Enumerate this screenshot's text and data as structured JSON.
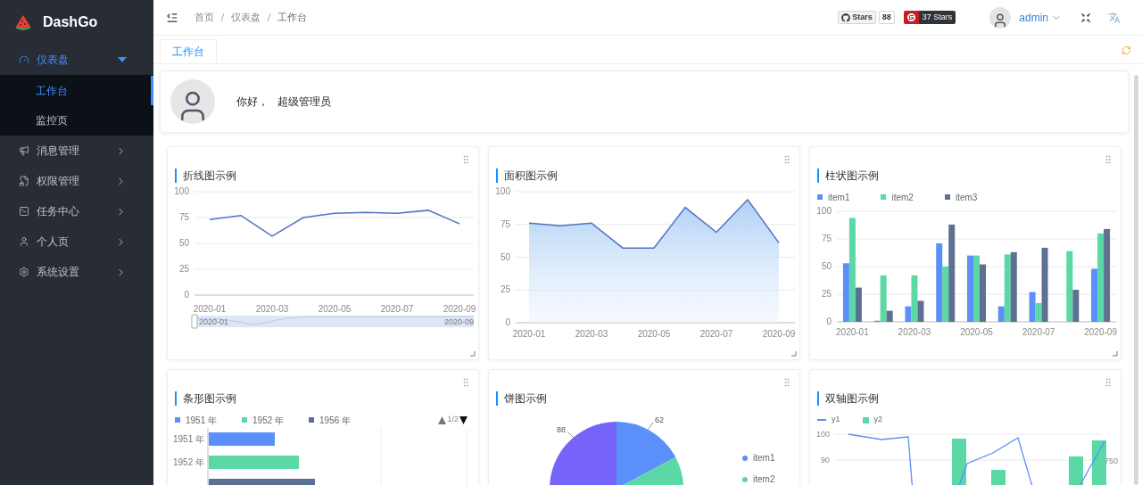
{
  "sidebar": {
    "logo": "DashGo",
    "menu": [
      {
        "label": "仪表盘",
        "selected": true,
        "expanded": true,
        "children": [
          {
            "label": "工作台",
            "selected": true
          },
          {
            "label": "监控页",
            "selected": false
          }
        ]
      },
      {
        "label": "消息管理",
        "selected": false,
        "expanded": false
      },
      {
        "label": "权限管理",
        "selected": false,
        "expanded": false
      },
      {
        "label": "任务中心",
        "selected": false,
        "expanded": false
      },
      {
        "label": "个人页",
        "selected": false,
        "expanded": false
      },
      {
        "label": "系统设置",
        "selected": false,
        "expanded": false
      }
    ]
  },
  "header": {
    "breadcrumb": [
      "首页",
      "仪表盘",
      "工作台"
    ],
    "github": {
      "label": "Stars",
      "count": "88"
    },
    "gitee": {
      "label": "37 Stars"
    },
    "user": "admin"
  },
  "tabs": [
    {
      "label": "工作台",
      "selected": true
    }
  ],
  "welcome": {
    "greeting": "你好，",
    "name": "超级管理员"
  },
  "cards": [
    {
      "kind": "line",
      "title": "折线图示例",
      "zoom_slider": {
        "start": "2020-01",
        "end": "2020-09"
      },
      "chart_data": {
        "type": "line",
        "categories": [
          "2020-01",
          null,
          "2020-03",
          null,
          "2020-05",
          null,
          "2020-07",
          null,
          "2020-09"
        ],
        "ylim": [
          0,
          100
        ],
        "yticks": [
          0,
          25,
          50,
          75,
          100
        ],
        "grid": true,
        "series": [
          {
            "color": "#5470c6",
            "values": [
              73,
              77,
              57,
              75,
              79,
              80,
              79,
              82,
              69
            ]
          }
        ]
      }
    },
    {
      "kind": "area",
      "title": "面积图示例",
      "chart_data": {
        "type": "area",
        "categories": [
          "2020-01",
          null,
          "2020-03",
          null,
          "2020-05",
          null,
          "2020-07",
          null,
          "2020-09"
        ],
        "ylim": [
          0,
          100
        ],
        "yticks": [
          0,
          25,
          50,
          75,
          100
        ],
        "grid": true,
        "series": [
          {
            "color": "#5470c6",
            "values": [
              76,
              74,
              76,
              57,
              57,
              88,
              69,
              94,
              61
            ]
          }
        ]
      }
    },
    {
      "kind": "bar",
      "title": "柱状图示例",
      "chart_data": {
        "type": "bar",
        "categories": [
          "2020-01",
          null,
          "2020-03",
          null,
          "2020-05",
          null,
          "2020-07",
          null,
          "2020-09"
        ],
        "ylim": [
          0,
          100
        ],
        "yticks": [
          0,
          25,
          50,
          75,
          100
        ],
        "grid": true,
        "series": [
          {
            "name": "item1",
            "color": "#5b8ff9",
            "values": [
              53,
              1,
              14,
              71,
              60,
              14,
              27,
              0,
              48
            ]
          },
          {
            "name": "item2",
            "color": "#5ad8a6",
            "values": [
              94,
              42,
              42,
              50,
              60,
              61,
              17,
              64,
              80
            ]
          },
          {
            "name": "item3",
            "color": "#5d7092",
            "values": [
              31,
              10,
              19,
              88,
              52,
              63,
              67,
              29,
              84
            ]
          }
        ]
      }
    },
    {
      "kind": "hbar",
      "title": "条形图示例",
      "legend": [
        {
          "label": "1951 年",
          "color": "#5b8ff9"
        },
        {
          "label": "1952 年",
          "color": "#5ad8a6"
        },
        {
          "label": "1956 年",
          "color": "#5d7092"
        }
      ],
      "pager": "1/2",
      "categories": [
        "1951 年",
        "1952 年"
      ]
    },
    {
      "kind": "pie",
      "title": "饼图示例",
      "slice_labels": [
        "62",
        "88"
      ],
      "legend": [
        {
          "label": "item1",
          "color": "#5b8ff9"
        },
        {
          "label": "item2",
          "color": "#5ad8a6"
        }
      ]
    },
    {
      "kind": "dual",
      "title": "双轴图示例",
      "legend": [
        {
          "label": "y1",
          "color": "#5b8ff9",
          "kind": "line"
        },
        {
          "label": "y2",
          "color": "#5ad8a6",
          "kind": "bar"
        }
      ],
      "left_ticks": [
        "100",
        "90"
      ],
      "right_ticks": [
        "750"
      ]
    }
  ]
}
